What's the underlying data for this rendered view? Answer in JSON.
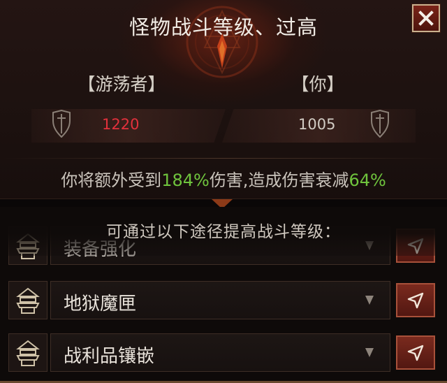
{
  "dialog": {
    "title": "怪物战斗等级、过高",
    "close_icon": "close-x-icon"
  },
  "comparison": {
    "monster": {
      "name": "【游荡者】",
      "level": "1220",
      "icon": "shield-icon",
      "level_color": "#e2313c"
    },
    "player": {
      "name": "【你】",
      "level": "1005",
      "icon": "shield-icon",
      "level_color": "#d2ccc4"
    }
  },
  "warning": {
    "part1": "你将额外受到",
    "damage_taken": "184%",
    "part2": "伤害,造成伤害衰减",
    "damage_reduction": "64%",
    "highlight_color": "#6fc43d"
  },
  "hint": "可通过以下途径提高战斗等级：",
  "methods": [
    {
      "label": "装备强化",
      "icon": "pagoda-icon"
    },
    {
      "label": "地狱魔匣",
      "icon": "pagoda-icon"
    },
    {
      "label": "战利品镶嵌",
      "icon": "pagoda-icon"
    }
  ]
}
